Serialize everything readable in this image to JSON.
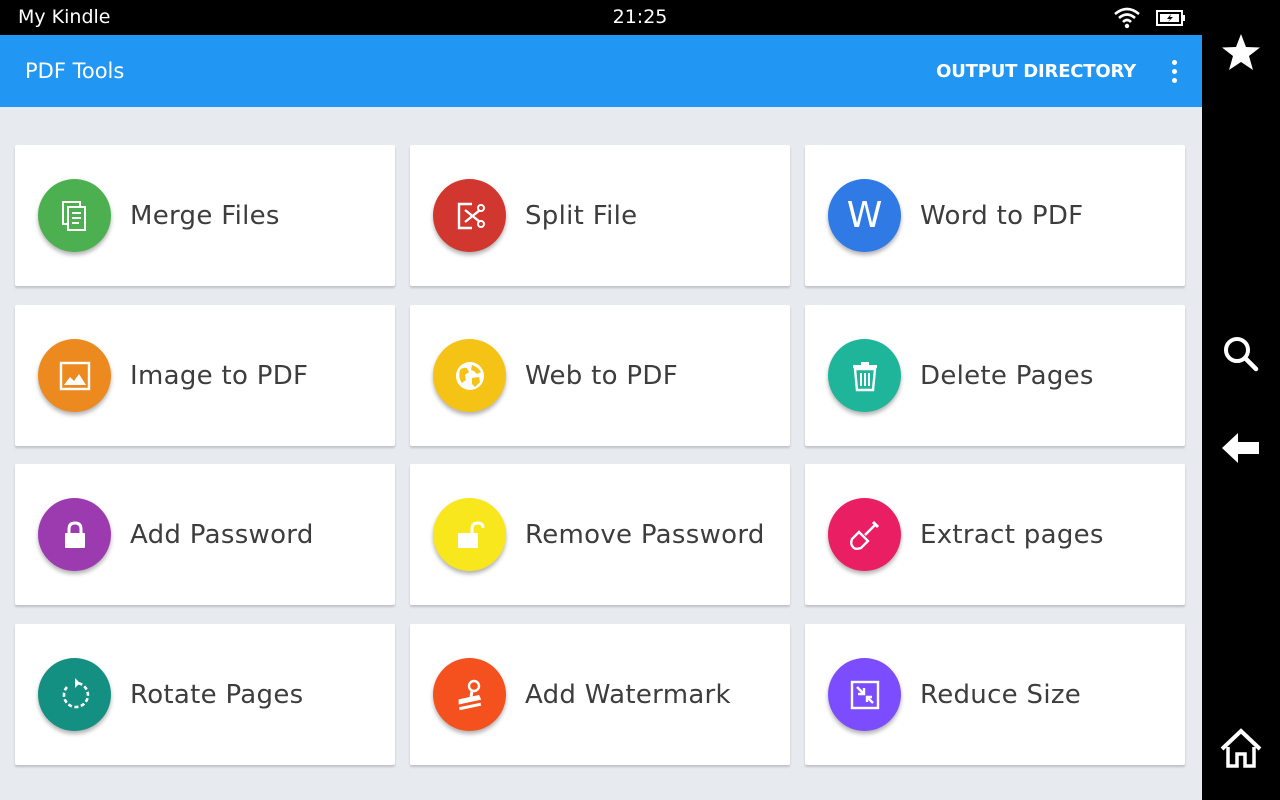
{
  "status_bar": {
    "device_name": "My Kindle",
    "time": "21:25",
    "icons": [
      "wifi-icon",
      "battery-charging-icon"
    ]
  },
  "app_bar": {
    "title": "PDF Tools",
    "action_label": "OUTPUT DIRECTORY",
    "menu_icon": "more-vert-icon"
  },
  "tools": [
    {
      "label": "Merge Files",
      "icon": "documents-icon",
      "color": "#4caf50"
    },
    {
      "label": "Split File",
      "icon": "scissors-icon",
      "color": "#d1372f"
    },
    {
      "label": "Word to PDF",
      "icon": "word-w-icon",
      "color": "#2f7ae5",
      "glyph": "W"
    },
    {
      "label": "Image to PDF",
      "icon": "image-icon",
      "color": "#ec8a1f"
    },
    {
      "label": "Web to PDF",
      "icon": "globe-icon",
      "color": "#f5c316"
    },
    {
      "label": "Delete Pages",
      "icon": "trash-icon",
      "color": "#1fb59a"
    },
    {
      "label": "Add Password",
      "icon": "lock-icon",
      "color": "#9c3bb0"
    },
    {
      "label": "Remove Password",
      "icon": "unlock-icon",
      "color": "#f8e71c"
    },
    {
      "label": "Extract pages",
      "icon": "shovel-icon",
      "color": "#e91e63"
    },
    {
      "label": "Rotate Pages",
      "icon": "rotate-icon",
      "color": "#149082"
    },
    {
      "label": "Add Watermark",
      "icon": "stamp-icon",
      "color": "#f4511e"
    },
    {
      "label": "Reduce Size",
      "icon": "compress-icon",
      "color": "#7c4dff"
    }
  ],
  "nav_bar": {
    "buttons": [
      "star-icon",
      "search-icon",
      "back-arrow-icon",
      "home-icon"
    ]
  }
}
